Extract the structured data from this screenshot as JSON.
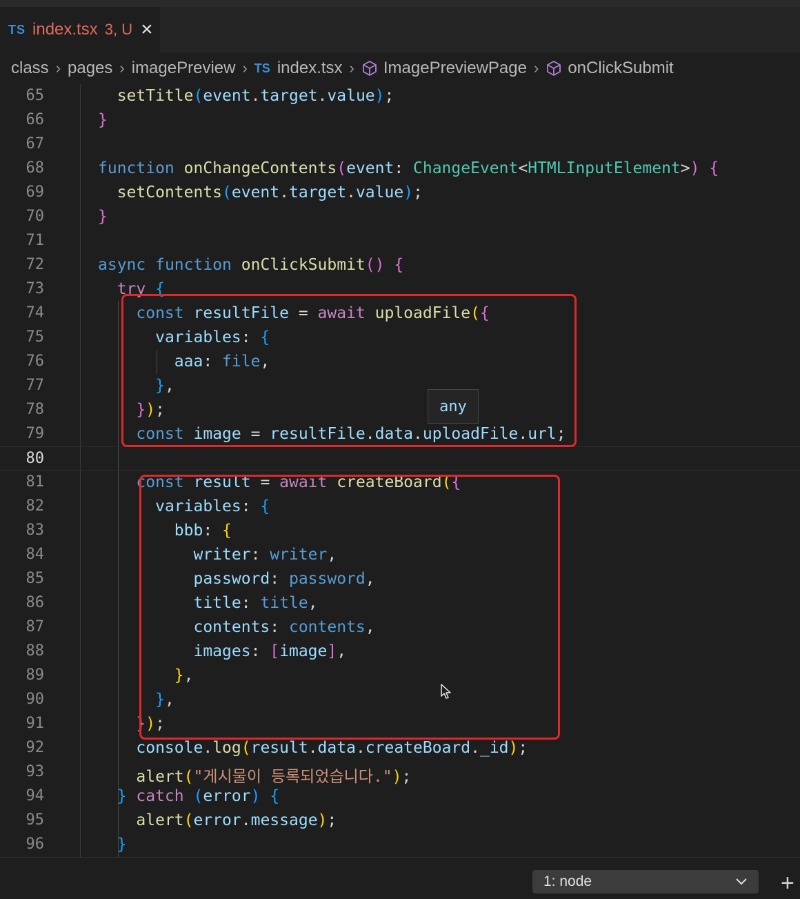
{
  "tab": {
    "lang_badge": "TS",
    "filename": "index.tsx",
    "status": "3, U"
  },
  "breadcrumb": {
    "items": [
      "class",
      "pages",
      "imagePreview",
      "index.tsx",
      "ImagePreviewPage",
      "onClickSubmit"
    ],
    "ts_badge": "TS"
  },
  "editor": {
    "lines": [
      {
        "n": "65"
      },
      {
        "n": "66"
      },
      {
        "n": "67"
      },
      {
        "n": "68"
      },
      {
        "n": "69"
      },
      {
        "n": "70"
      },
      {
        "n": "71"
      },
      {
        "n": "72"
      },
      {
        "n": "73"
      },
      {
        "n": "74"
      },
      {
        "n": "75"
      },
      {
        "n": "76"
      },
      {
        "n": "77"
      },
      {
        "n": "78"
      },
      {
        "n": "79"
      },
      {
        "n": "80"
      },
      {
        "n": "81"
      },
      {
        "n": "82"
      },
      {
        "n": "83"
      },
      {
        "n": "84"
      },
      {
        "n": "85"
      },
      {
        "n": "86"
      },
      {
        "n": "87"
      },
      {
        "n": "88"
      },
      {
        "n": "89"
      },
      {
        "n": "90"
      },
      {
        "n": "91"
      },
      {
        "n": "92"
      },
      {
        "n": "93"
      },
      {
        "n": "94"
      },
      {
        "n": "95"
      },
      {
        "n": "96"
      }
    ],
    "active_line": "80",
    "hover_type": "any"
  },
  "terminal": {
    "selected": "1: node"
  },
  "colors": {
    "highlight_box": "#e0282b",
    "keyword": "#569cd6",
    "function": "#dcdcaa",
    "variable": "#9cdcfe",
    "string": "#ce9178"
  },
  "icons": [
    "close-icon",
    "chevron-right-icon",
    "cube-icon",
    "chevron-down-icon",
    "plus-icon",
    "mouse-pointer-icon"
  ]
}
